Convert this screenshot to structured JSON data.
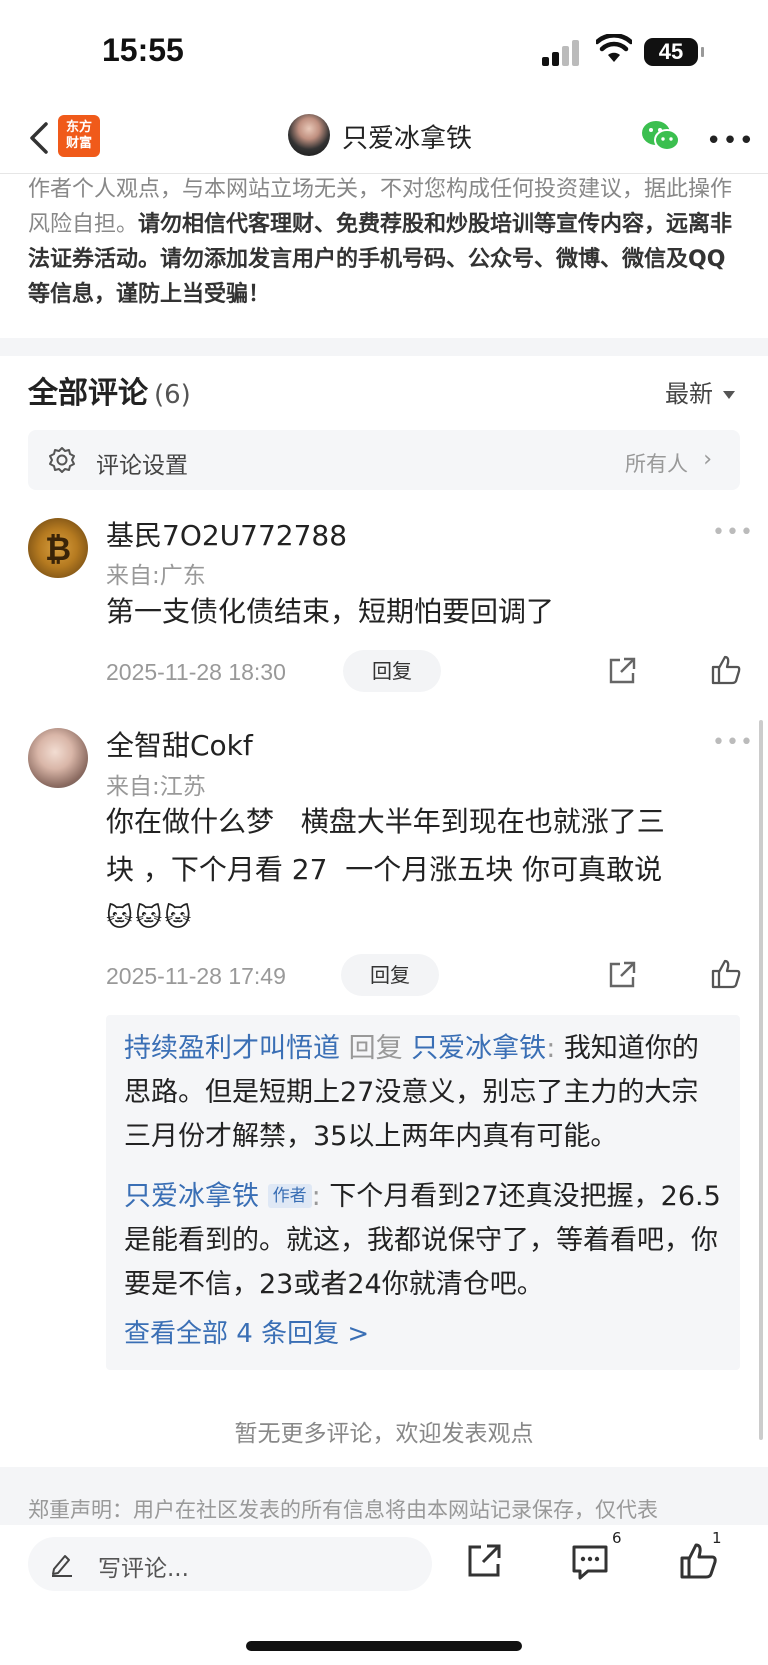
{
  "status_bar": {
    "time": "15:55",
    "battery": "45"
  },
  "nav": {
    "logo_line1": "东方",
    "logo_line2": "财富",
    "title": "只爱冰拿铁"
  },
  "disclaimer": {
    "plain1": "作者个人观点，与本网站立场无关，不对您构成任何投资建议，据此操作风险自担。",
    "bold": "请勿相信代客理财、免费荐股和炒股培训等宣传内容，远离非法证券活动。请勿添加发言用户的手机号码、公众号、微博、微信及QQ等信息，谨防上当受骗！"
  },
  "comments_header": {
    "title": "全部评论",
    "count": "(6)",
    "sort": "最新"
  },
  "settings": {
    "label": "评论设置",
    "value": "所有人"
  },
  "comments": [
    {
      "user": "基民7O2U772788",
      "location": "来自:广东",
      "text": "第一支债化债结束，短期怕要回调了",
      "date": "2025-11-28 18:30",
      "reply_label": "回复"
    },
    {
      "user": "全智甜Cokf",
      "location": "来自:江苏",
      "text_line1": "你在做什么梦   横盘大半年到现在也就涨了三",
      "text_line2": "块 ，下个月看 27  一个月涨五块 你可真敢说",
      "emoji": "🐱🐱🐱",
      "date": "2025-11-28 17:49",
      "reply_label": "回复",
      "replies": [
        {
          "from": "持续盈利才叫悟道",
          "mid": "回复",
          "to": "只爱冰拿铁",
          "sep": ":",
          "text": "我知道你的思路。但是短期上27没意义，别忘了主力的大宗三月份才解禁，35以上两年内真有可能。"
        },
        {
          "from": "只爱冰拿铁",
          "tag": "作者",
          "sep": ":",
          "text": "下个月看到27还真没把握，26.5是能看到的。就这，我都说保守了，等着看吧，你要是不信，23或者24你就清仓吧。"
        }
      ],
      "view_all": "查看全部 4 条回复 >"
    }
  ],
  "no_more": "暂无更多评论，欢迎发表观点",
  "notice": "郑重声明：用户在社区发表的所有信息将由本网站记录保存，仅代表",
  "bottom_bar": {
    "placeholder": "写评论...",
    "comment_count": "6",
    "like_count": "1"
  },
  "colors": {
    "link": "#3a6fb5",
    "logo": "#f05a1a",
    "wechat": "#3bbf4f"
  }
}
